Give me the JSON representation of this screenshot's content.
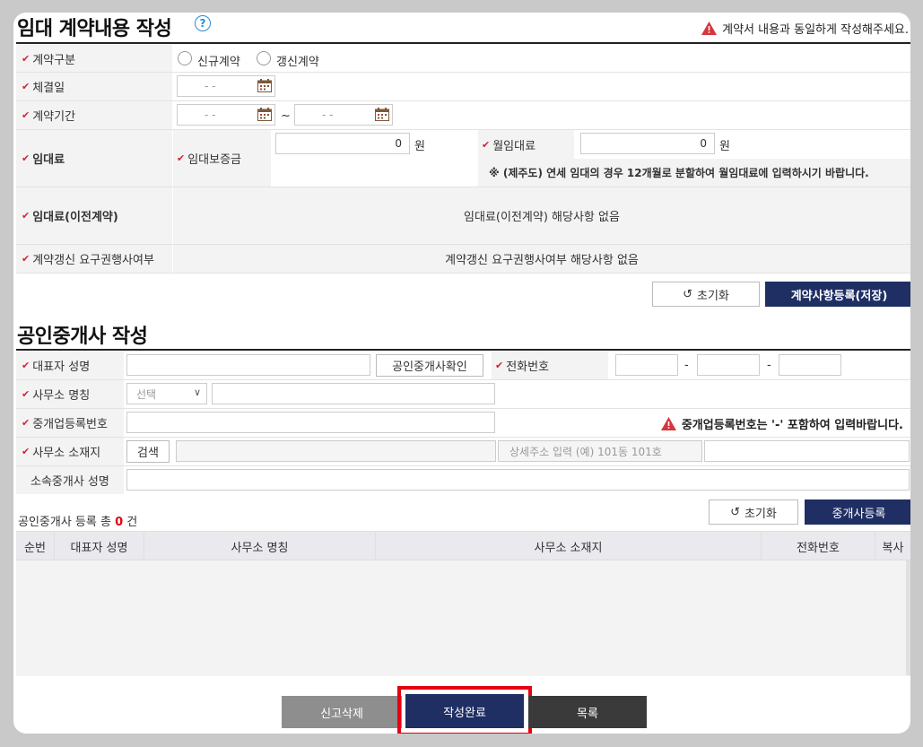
{
  "contract_section": {
    "title": "임대 계약내용 작성",
    "warning": "계약서 내용과 동일하게 작성해주세요.",
    "rows": {
      "type_label": "계약구분",
      "type_options": [
        "신규계약",
        "갱신계약"
      ],
      "date_label": "체결일",
      "date_placeholder": "- -",
      "period_label": "계약기간",
      "period_tilde": "~",
      "rent_label": "임대료",
      "deposit_label": "임대보증금",
      "deposit_value": "0",
      "currency": "원",
      "monthly_label": "월임대료",
      "monthly_value": "0",
      "monthly_note": "※ (제주도) 연세 임대의 경우 12개월로 분할하여 월임대료에 입력하시기 바랍니다.",
      "prev_label": "임대료(이전계약)",
      "prev_value": "임대료(이전계약) 해당사항 없음",
      "renew_label": "계약갱신 요구권행사여부",
      "renew_value": "계약갱신 요구권행사여부 해당사항 없음"
    },
    "reset_label": "초기화",
    "save_label": "계약사항등록(저장)"
  },
  "agent_section": {
    "title": "공인중개사 작성",
    "rep_label": "대표자 성명",
    "verify_label": "공인중개사확인",
    "phone_label": "전화번호",
    "phone_sep": "-",
    "office_label": "사무소 명칭",
    "select_placeholder": "선택",
    "reg_label": "중개업등록번호",
    "reg_warning": "중개업등록번호는  '-' 포함하여 입력바랍니다.",
    "addr_label": "사무소 소재지",
    "search_label": "검색",
    "addr_detail_placeholder": "상세주소 입력 (예) 101동 101호",
    "member_label": "소속중개사 성명",
    "count_prefix": "공인중개사 등록 총",
    "count_value": "0",
    "count_suffix": "건",
    "reset_label": "초기화",
    "register_label": "중개사등록",
    "table_headers": [
      "순번",
      "대표자 성명",
      "사무소 명칭",
      "사무소 소재지",
      "전화번호",
      "복사"
    ]
  },
  "footer": {
    "delete_label": "신고삭제",
    "complete_label": "작성완료",
    "list_label": "목록"
  },
  "colors": {
    "navy": "#1f2e63",
    "check_red": "#d0253a",
    "highlight": "#e60012"
  }
}
